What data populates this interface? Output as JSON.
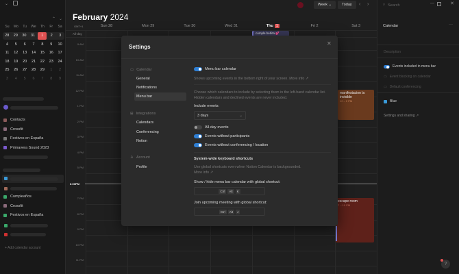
{
  "sidebar": {
    "weekdays": [
      "Su",
      "Mo",
      "Tu",
      "We",
      "Th",
      "Fr",
      "Sa"
    ],
    "weeks": [
      [
        "28",
        "29",
        "30",
        "31",
        "1",
        "2",
        "3"
      ],
      [
        "4",
        "5",
        "6",
        "7",
        "8",
        "9",
        "10"
      ],
      [
        "11",
        "12",
        "13",
        "14",
        "15",
        "16",
        "17"
      ],
      [
        "18",
        "19",
        "20",
        "21",
        "22",
        "23",
        "24"
      ],
      [
        "25",
        "26",
        "27",
        "28",
        "29",
        "1",
        "2"
      ],
      [
        "3",
        "4",
        "5",
        "6",
        "7",
        "8",
        "9"
      ]
    ],
    "calendars_group1": [
      {
        "label": "Contacts",
        "color": "#8a5a5a"
      },
      {
        "label": "Crossfit",
        "color": "#8a6a7a"
      },
      {
        "label": "Festivos en España",
        "color": "#777777"
      },
      {
        "label": "Primavera Sound 2023",
        "color": "#7a5acc"
      }
    ],
    "calendars_group2": [
      {
        "label": "Cumpleaños",
        "color": "#3aa86a"
      },
      {
        "label": "Crossfit",
        "color": "#8a6a7a"
      },
      {
        "label": "Festivos en España",
        "color": "#3aa86a"
      }
    ],
    "add_account": "+ Add calendar account"
  },
  "header": {
    "month": "February",
    "year": "2024",
    "view": "Week",
    "today": "Today",
    "timezone": "GMT+1",
    "allday": "All-day"
  },
  "days": [
    {
      "label": "Sun 28"
    },
    {
      "label": "Mon 29"
    },
    {
      "label": "Tue 30"
    },
    {
      "label": "Wed 31"
    },
    {
      "label": "Thu",
      "badge": "1"
    },
    {
      "label": "Fri 2"
    },
    {
      "label": "Sat 3"
    }
  ],
  "times": [
    "9 AM",
    "10 AM",
    "11 AM",
    "12 PM",
    "1 PM",
    "2 PM",
    "3 PM",
    "4 PM",
    "5 PM",
    "6 PM",
    "7 PM",
    "8 PM",
    "9 PM",
    "10 PM",
    "11 PM"
  ],
  "current_time": "6:00PM",
  "events": {
    "cumple": "cumple bebita 💕",
    "manif_title": "manifestacion la invisible",
    "manif_time": "12 – 2 PM",
    "escape_title": "escape room",
    "escape_time": "7 – 10 PM"
  },
  "right_panel": {
    "search": "Search",
    "title": "Calendar",
    "description": "Description",
    "menu_bar": "Events included in menu bar",
    "blocking": "Event blocking on calendar",
    "conferencing": "Default conferencing",
    "color": "Blue",
    "settings": "Settings and sharing ↗",
    "help": "?"
  },
  "settings": {
    "title": "Settings",
    "nav": {
      "calendar": "Calendar",
      "general": "General",
      "notifications": "Notifications",
      "menu_bar": "Menu bar",
      "integrations": "Integrations",
      "calendars": "Calendars",
      "conferencing": "Conferencing",
      "notion": "Notion",
      "account": "Account",
      "profile": "Profile"
    },
    "menu_bar_calendar": "Menu bar calendar",
    "menu_bar_desc": "Shows upcoming events in the bottom right of your screen. More info ↗",
    "choose_desc": "Choose which calendars to include by selecting them in the left-hand calendar list. Hidden calendars and declined events are never included.",
    "include_label": "Include events:",
    "include_value": "3 days",
    "allday": "All-day events",
    "no_participants": "Events without participants",
    "no_conferencing": "Events without conferencing / location",
    "shortcuts_title": "System-wide keyboard shortcuts",
    "shortcuts_desc": "Use global shortcuts even when Notion Calendar is backgrounded.",
    "more_info": "More info ↗",
    "show_hide_label": "Show / hide menu bar calendar with global shortcut:",
    "show_hide_keys": [
      "Ctrl",
      "Alt",
      "K"
    ],
    "join_label": "Join upcoming meeting with global shortcut:",
    "join_keys": [
      "Ctrl",
      "Alt",
      "J"
    ]
  }
}
